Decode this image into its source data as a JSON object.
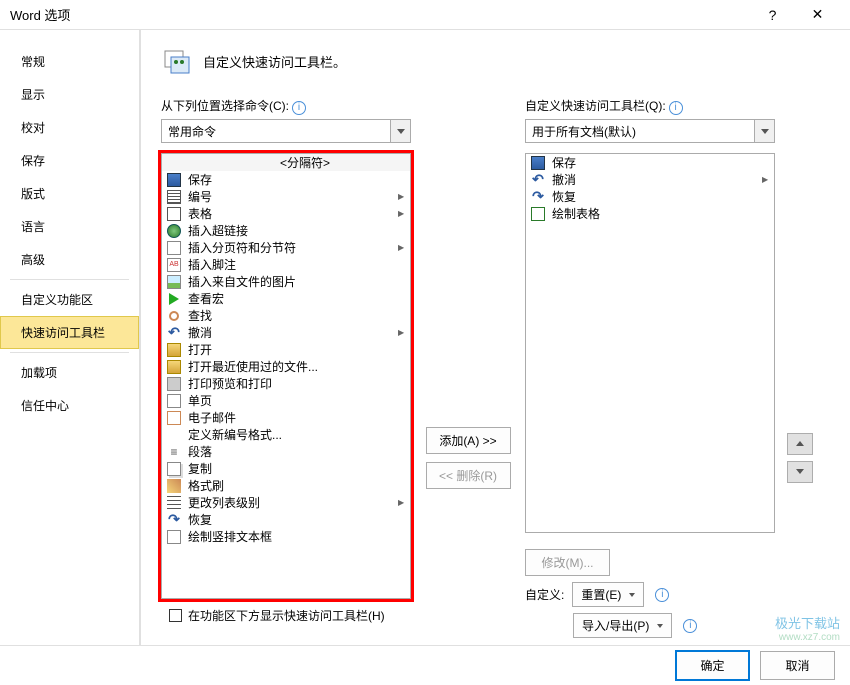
{
  "window": {
    "title": "Word 选项",
    "help": "?",
    "close": "✕"
  },
  "sidebar": {
    "items": [
      {
        "label": "常规",
        "active": false
      },
      {
        "label": "显示",
        "active": false
      },
      {
        "label": "校对",
        "active": false
      },
      {
        "label": "保存",
        "active": false
      },
      {
        "label": "版式",
        "active": false
      },
      {
        "label": "语言",
        "active": false
      },
      {
        "label": "高级",
        "active": false
      },
      {
        "label": "自定义功能区",
        "active": false,
        "divider_before": true
      },
      {
        "label": "快速访问工具栏",
        "active": true
      },
      {
        "label": "加载项",
        "active": false,
        "divider_before": true
      },
      {
        "label": "信任中心",
        "active": false
      }
    ]
  },
  "header": {
    "text": "自定义快速访问工具栏。"
  },
  "left_panel": {
    "label": "从下列位置选择命令(C):",
    "dropdown": "常用命令",
    "items": [
      {
        "label": "<分隔符>",
        "icon": "",
        "separator": true
      },
      {
        "label": "保存",
        "icon": "save"
      },
      {
        "label": "编号",
        "icon": "num",
        "submenu": true
      },
      {
        "label": "表格",
        "icon": "table",
        "submenu": true
      },
      {
        "label": "插入超链接",
        "icon": "globe"
      },
      {
        "label": "插入分页符和分节符",
        "icon": "page",
        "submenu": true
      },
      {
        "label": "插入脚注",
        "icon": "ab"
      },
      {
        "label": "插入来自文件的图片",
        "icon": "pic"
      },
      {
        "label": "查看宏",
        "icon": "play"
      },
      {
        "label": "查找",
        "icon": "find"
      },
      {
        "label": "撤消",
        "icon": "undo",
        "submenu": true
      },
      {
        "label": "打开",
        "icon": "open"
      },
      {
        "label": "打开最近使用过的文件...",
        "icon": "open"
      },
      {
        "label": "打印预览和打印",
        "icon": "print"
      },
      {
        "label": "单页",
        "icon": "page"
      },
      {
        "label": "电子邮件",
        "icon": "mail"
      },
      {
        "label": "定义新编号格式...",
        "icon": ""
      },
      {
        "label": "段落",
        "icon": "para"
      },
      {
        "label": "复制",
        "icon": "copy"
      },
      {
        "label": "格式刷",
        "icon": "brush"
      },
      {
        "label": "更改列表级别",
        "icon": "list",
        "submenu": true
      },
      {
        "label": "恢复",
        "icon": "redo"
      },
      {
        "label": "绘制竖排文本框",
        "icon": "page"
      }
    ]
  },
  "right_panel": {
    "label": "自定义快速访问工具栏(Q):",
    "dropdown": "用于所有文档(默认)",
    "items": [
      {
        "label": "保存",
        "icon": "save"
      },
      {
        "label": "撤消",
        "icon": "undo",
        "submenu": true
      },
      {
        "label": "恢复",
        "icon": "redo"
      },
      {
        "label": "绘制表格",
        "icon": "drawtable"
      }
    ]
  },
  "buttons": {
    "add": "添加(A) >>",
    "remove": "<< 删除(R)",
    "modify": "修改(M)...",
    "reset": "重置(E)",
    "import_export": "导入/导出(P)",
    "customize_label": "自定义:",
    "ok": "确定",
    "cancel": "取消"
  },
  "checkbox": {
    "label": "在功能区下方显示快速访问工具栏(H)"
  },
  "watermark": {
    "main": "极光下载站",
    "sub": "www.xz7.com"
  }
}
